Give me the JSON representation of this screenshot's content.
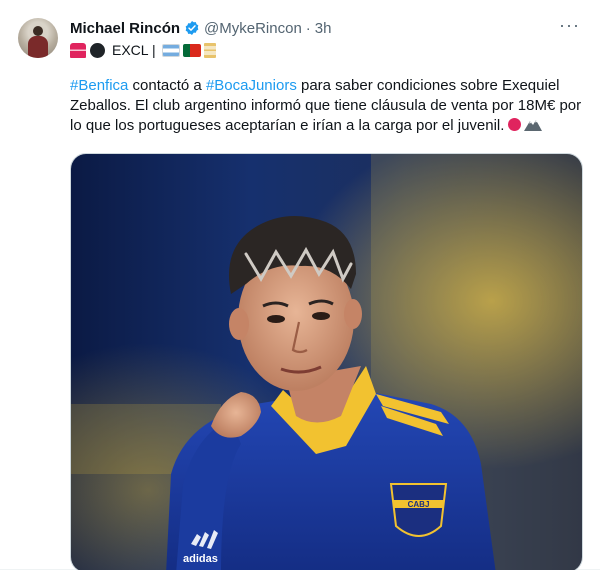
{
  "tweet": {
    "author_name": "Michael Rincón",
    "author_handle": "@MykeRincon",
    "separator": "·",
    "time": "3h",
    "more_label": "···",
    "bio_label": "EXCL |",
    "bio_emoji": [
      "siren-icon",
      "bomb-icon",
      "flag-argentina-icon",
      "flag-portugal-icon",
      "hourglass-icon"
    ],
    "body": {
      "hashtag1": "#Benfica",
      "text1": " contactó a ",
      "hashtag2": "#BocaJuniors",
      "text2": " para saber condiciones sobre Exequiel Zeballos. El club argentino informó que tiene cláusula de venta por 18M€ por lo que los portugueses aceptarían e irían a la carga por el juvenil."
    },
    "media": {
      "badge_text": "CABJ",
      "kit_brand": "adidas"
    }
  },
  "colors": {
    "text": "#0f1419",
    "secondary": "#536471",
    "link": "#1d9bf0",
    "verified": "#1d9bf0",
    "boca_blue": "#1a3fa0",
    "boca_yellow": "#f2c230"
  }
}
